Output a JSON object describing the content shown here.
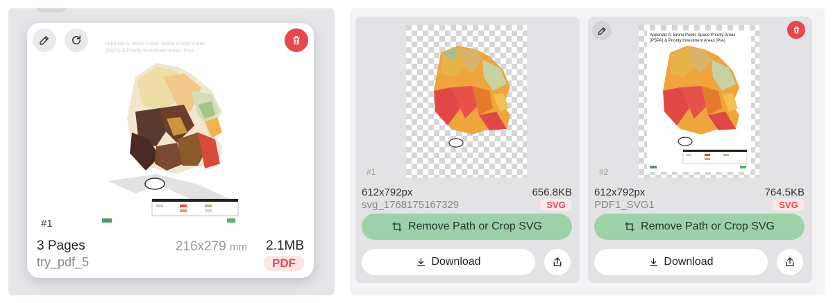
{
  "pdf_card": {
    "index": "#1",
    "pages": "3 Pages",
    "filename": "try_pdf_5",
    "dimensions": "216x279",
    "dimensions_unit": "mm",
    "size": "2.1MB",
    "type_badge": "PDF",
    "map_title": "Appendix A: Bronx Public Space Priority Areas (PSPA) & Priority Investment Areas (PIA)",
    "icons": [
      "edit-icon",
      "rotate-icon",
      "trash-icon"
    ]
  },
  "svg_cards": [
    {
      "index": "#1",
      "dimensions": "612x792px",
      "size": "656.8KB",
      "filename": "svg_1768175167329",
      "type_badge": "SVG",
      "crop_label": "Remove Path or Crop SVG",
      "download_label": "Download",
      "icons": [
        "crop-icon",
        "download-icon",
        "share-icon"
      ]
    },
    {
      "index": "#2",
      "dimensions": "612x792px",
      "size": "764.5KB",
      "filename": "PDF1_SVG1",
      "type_badge": "SVG",
      "crop_label": "Remove Path or Crop SVG",
      "download_label": "Download",
      "map_title": "Appendix A: Bronx Public Space Priority Areas (PSPA) & Priority Investment Areas (PIA)",
      "icons": [
        "edit-icon",
        "trash-icon",
        "crop-icon",
        "download-icon",
        "share-icon"
      ]
    }
  ],
  "colors": {
    "accent_red": "#e5484d",
    "crop_button": "#9bd2a9",
    "badge_bg": "#fde6e6"
  }
}
